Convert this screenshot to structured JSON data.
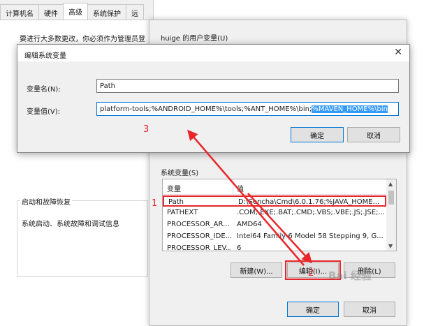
{
  "system_properties": {
    "tabs": [
      {
        "label": "计算机名",
        "active": false
      },
      {
        "label": "硬件",
        "active": false
      },
      {
        "label": "高级",
        "active": true
      },
      {
        "label": "系统保护",
        "active": false
      },
      {
        "label": "远",
        "active": false
      }
    ],
    "admin_note": "要进行大多数更改，你必须作为管理员登",
    "startup_group": {
      "title": "启动和故障恢复",
      "description": "系统启动、系统故障和调试信息"
    }
  },
  "env_window": {
    "user_vars_label": "huige 的用户变量(U)",
    "system_vars_label": "系统变量(S)",
    "columns": {
      "name": "变量",
      "value": "值"
    },
    "rows": [
      {
        "name": "Path",
        "value": "D:\\Sencha\\Cmd\\6.0.1.76;%JAVA_HOME...",
        "selected": true
      },
      {
        "name": "PATHEXT",
        "value": ".COM;.EXE;.BAT;.CMD;.VBS;.VBE;.JS;.JSE;...",
        "selected": false
      },
      {
        "name": "PROCESSOR_AR...",
        "value": "AMD64",
        "selected": false
      },
      {
        "name": "PROCESSOR_IDE...",
        "value": "Intel64 Family 6 Model 58 Stepping 9, G...",
        "selected": false
      },
      {
        "name": "PROCESSOR_LEV...",
        "value": "6",
        "selected": false
      }
    ],
    "buttons": {
      "new": "新建(W)...",
      "edit": "编辑(I)...",
      "delete": "删除(L)",
      "ok": "确定",
      "cancel": "取消"
    }
  },
  "edit_dialog": {
    "title": "编辑系统变量",
    "name_label": "变量名(N):",
    "name_value": "Path",
    "value_label": "变量值(V):",
    "value_plain": "platform-tools;%ANDROID_HOME%\\tools;%ANT_HOME%\\bin;",
    "value_selected": "%MAVEN_HOME%\\bin",
    "ok_label": "确定",
    "cancel_label": "取消"
  },
  "annotations": {
    "step1": "1",
    "step2": "2",
    "step3": "3"
  },
  "watermark": "Bai 经验",
  "colors": {
    "highlight_red": "#e8262a",
    "selection_blue": "#3399ff",
    "accent": "#0078d7"
  }
}
